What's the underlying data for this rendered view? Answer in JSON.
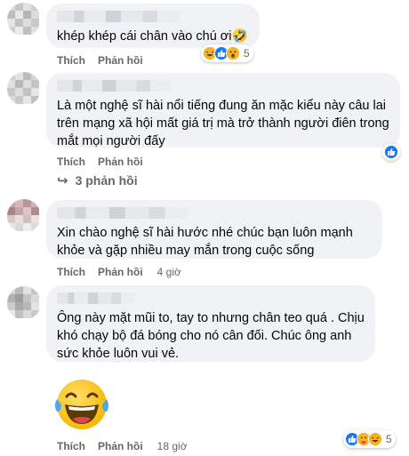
{
  "actions": {
    "like_label": "Thích",
    "reply_label": "Phản hồi"
  },
  "comments": [
    {
      "text": "khép khép cái chân vào chú ơi🤣",
      "time": "",
      "reaction_count": "5"
    },
    {
      "text": "Là một nghệ sĩ hài nổi tiếng đung ăn mặc kiểu này câu lai trên mạng xã hội mất giá trị mà trở thành người điên trong mắt mọi người đấy",
      "time": "",
      "reaction_count": ""
    },
    {
      "text": "Xin chào nghệ sĩ hài hước nhé chúc bạn luôn mạnh khỏe và gặp nhiều may mắn trong cuộc sống",
      "time": "4 giờ",
      "reaction_count": ""
    },
    {
      "text": "Ông này mặt mũi to, tay to nhưng chân teo quá . Chịu khó chạy bộ đá bóng cho nó cân đối. Chúc ông anh sức khỏe luôn vui vẻ.",
      "time": "",
      "reaction_count": ""
    },
    {
      "text": "",
      "time": "18 giờ",
      "reaction_count": "5"
    }
  ],
  "replies_link": "3 phản hồi",
  "icons": {
    "like": "like-reaction-icon",
    "haha": "haha-reaction-icon",
    "wow": "wow-reaction-icon",
    "care": "care-reaction-icon",
    "reply_arrow": "reply-arrow-icon",
    "sticker": "laughing-tears-emoji"
  },
  "colors": {
    "bubble": "#f0f2f5",
    "meta": "#65676b",
    "like_blue": "#1877f2",
    "emoji_yellow": "#f7b125"
  }
}
